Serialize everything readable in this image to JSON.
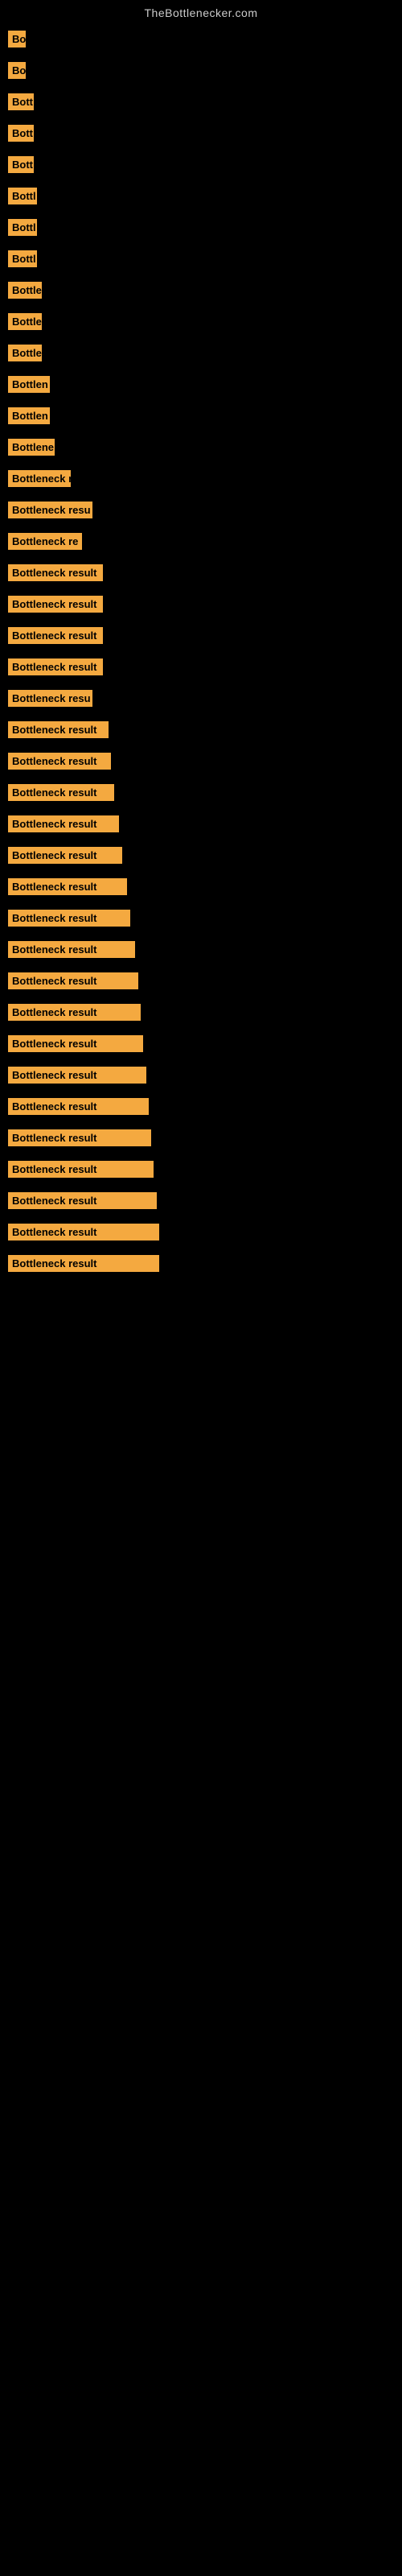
{
  "site": {
    "title": "TheBottlenecker.com"
  },
  "items": [
    {
      "label": "Bo",
      "width": 22
    },
    {
      "label": "Bo",
      "width": 22
    },
    {
      "label": "Bott",
      "width": 32
    },
    {
      "label": "Bott",
      "width": 32
    },
    {
      "label": "Bott",
      "width": 32
    },
    {
      "label": "Bottl",
      "width": 36
    },
    {
      "label": "Bottl",
      "width": 36
    },
    {
      "label": "Bottl",
      "width": 36
    },
    {
      "label": "Bottle",
      "width": 42
    },
    {
      "label": "Bottle",
      "width": 42
    },
    {
      "label": "Bottle",
      "width": 42
    },
    {
      "label": "Bottlen",
      "width": 52
    },
    {
      "label": "Bottlen",
      "width": 52
    },
    {
      "label": "Bottlene",
      "width": 58
    },
    {
      "label": "Bottleneck r",
      "width": 78
    },
    {
      "label": "Bottleneck resu",
      "width": 105
    },
    {
      "label": "Bottleneck re",
      "width": 92
    },
    {
      "label": "Bottleneck result",
      "width": 118
    },
    {
      "label": "Bottleneck result",
      "width": 118
    },
    {
      "label": "Bottleneck result",
      "width": 118
    },
    {
      "label": "Bottleneck result",
      "width": 118
    },
    {
      "label": "Bottleneck resu",
      "width": 105
    },
    {
      "label": "Bottleneck result",
      "width": 125
    },
    {
      "label": "Bottleneck result",
      "width": 128
    },
    {
      "label": "Bottleneck result",
      "width": 132
    },
    {
      "label": "Bottleneck result",
      "width": 138
    },
    {
      "label": "Bottleneck result",
      "width": 142
    },
    {
      "label": "Bottleneck result",
      "width": 148
    },
    {
      "label": "Bottleneck result",
      "width": 152
    },
    {
      "label": "Bottleneck result",
      "width": 158
    },
    {
      "label": "Bottleneck result",
      "width": 162
    },
    {
      "label": "Bottleneck result",
      "width": 165
    },
    {
      "label": "Bottleneck result",
      "width": 168
    },
    {
      "label": "Bottleneck result",
      "width": 172
    },
    {
      "label": "Bottleneck result",
      "width": 175
    },
    {
      "label": "Bottleneck result",
      "width": 178
    },
    {
      "label": "Bottleneck result",
      "width": 181
    },
    {
      "label": "Bottleneck result",
      "width": 185
    },
    {
      "label": "Bottleneck result",
      "width": 188
    },
    {
      "label": "Bottleneck result",
      "width": 188
    }
  ]
}
